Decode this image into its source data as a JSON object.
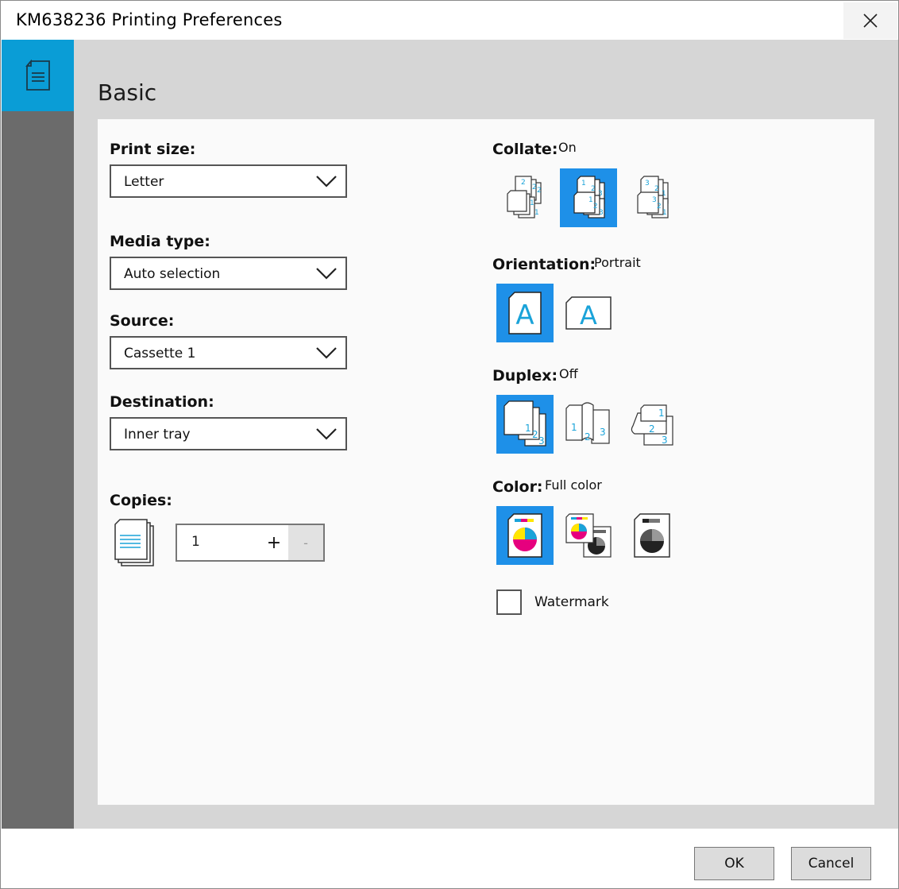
{
  "window": {
    "title": "KM638236 Printing Preferences"
  },
  "sidebar": {
    "items": [
      {
        "name": "basic",
        "icon": "document-icon"
      }
    ]
  },
  "page": {
    "title": "Basic"
  },
  "left": {
    "print_size": {
      "label": "Print size:",
      "value": "Letter"
    },
    "media_type": {
      "label": "Media type:",
      "value": "Auto selection"
    },
    "source": {
      "label": "Source:",
      "value": "Cassette 1"
    },
    "destination": {
      "label": "Destination:",
      "value": "Inner tray"
    },
    "copies": {
      "label": "Copies:",
      "value": "1",
      "plus": "+",
      "minus": "-"
    }
  },
  "right": {
    "collate": {
      "label": "Collate:",
      "value": "On"
    },
    "orientation": {
      "label": "Orientation:",
      "value": "Portrait"
    },
    "duplex": {
      "label": "Duplex:",
      "value": "Off"
    },
    "color": {
      "label": "Color:",
      "value": "Full color"
    },
    "watermark": {
      "label": "Watermark",
      "checked": false
    }
  },
  "footer": {
    "ok": "OK",
    "cancel": "Cancel"
  },
  "colors": {
    "accent": "#1e90e8",
    "sidebar_active": "#0a9dd6",
    "sidebar": "#6b6b6b",
    "background": "#d6d6d6",
    "cyan": "#1aa3d9",
    "magenta": "#e6007e",
    "yellow": "#ffe600"
  }
}
